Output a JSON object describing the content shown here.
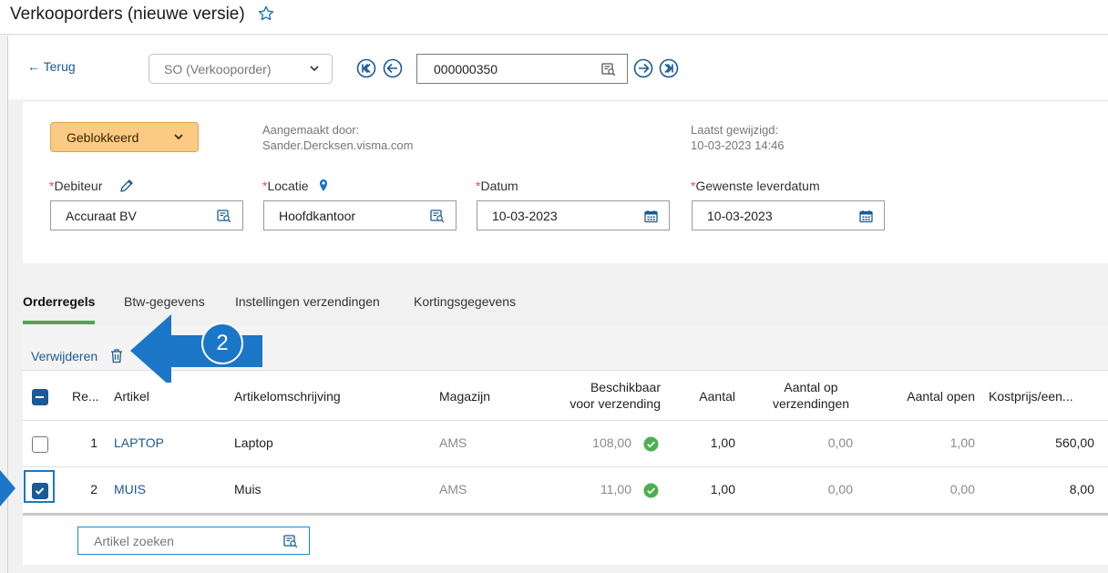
{
  "window": {
    "title": "Verkooporders (nieuwe versie)"
  },
  "toolbar": {
    "back_label": "← Terug",
    "order_type": "SO (Verkooporder)",
    "order_number": "000000350"
  },
  "header": {
    "status": "Geblokkeerd",
    "created_by_label": "Aangemaakt door:",
    "created_by_value": "Sander.Dercksen.visma.com",
    "last_modified_label": "Laatst gewijzigd:",
    "last_modified_value": "10-03-2023 14:46",
    "required_mark": "*",
    "fields": {
      "debtor": {
        "label": "Debiteur",
        "value": "Accuraat BV"
      },
      "location": {
        "label": "Locatie",
        "value": "Hoofdkantoor"
      },
      "date": {
        "label": "Datum",
        "value": "10-03-2023"
      },
      "delivery_date": {
        "label": "Gewenste leverdatum",
        "value": "10-03-2023"
      }
    }
  },
  "tabs": [
    {
      "label": "Orderregels",
      "active": true
    },
    {
      "label": "Btw-gegevens",
      "active": false
    },
    {
      "label": "Instellingen verzendingen",
      "active": false
    },
    {
      "label": "Kortingsgegevens",
      "active": false
    }
  ],
  "grid": {
    "delete_label": "Verwijderen",
    "columns": {
      "line": "Re...",
      "item": "Artikel",
      "description": "Artikelomschrijving",
      "warehouse": "Magazijn",
      "available_1": "Beschikbaar",
      "available_2": "voor verzending",
      "qty": "Aantal",
      "on_shipments_1": "Aantal op",
      "on_shipments_2": "verzendingen",
      "open_qty": "Aantal open",
      "cost": "Kostprijs/een..."
    },
    "rows": [
      {
        "selected": false,
        "line": "1",
        "item": "LAPTOP",
        "description": "Laptop",
        "warehouse": "AMS",
        "available": "108,00",
        "qty": "1,00",
        "on_shipments": "0,00",
        "open_qty": "1,00",
        "cost": "560,00"
      },
      {
        "selected": true,
        "line": "2",
        "item": "MUIS",
        "description": "Muis",
        "warehouse": "AMS",
        "available": "11,00",
        "qty": "1,00",
        "on_shipments": "0,00",
        "open_qty": "0,00",
        "cost": "8,00"
      }
    ],
    "search_placeholder": "Artikel zoeken"
  },
  "annotation": {
    "step_number": "2"
  },
  "colors": {
    "link": "#1a5a96",
    "status_bg": "#fccb83",
    "tab_active": "#53a653",
    "ok_green": "#4caf50",
    "callout_blue": "#1c76c8",
    "required": "#d9534f"
  },
  "icons": [
    "star-icon",
    "chevron-down-icon",
    "first-record-icon",
    "previous-record-icon",
    "next-record-icon",
    "last-record-icon",
    "lookup-icon",
    "pencil-icon",
    "location-pin-icon",
    "calendar-icon",
    "trash-icon",
    "check-circle-icon",
    "arrow-callout-icon"
  ]
}
